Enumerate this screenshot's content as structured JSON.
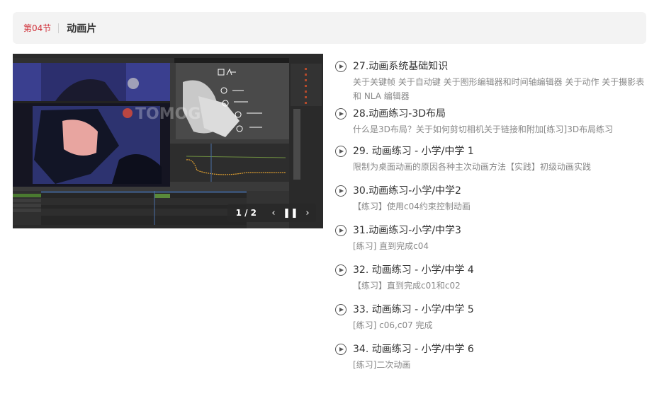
{
  "section": {
    "number": "第04节",
    "title": "动画片"
  },
  "video": {
    "counter": "1 / 2",
    "logo_text": "TOMOG"
  },
  "lessons": [
    {
      "title": "27.动画系统基础知识",
      "desc": "关于关键帧 关于自动键 关于图形编辑器和时间轴编辑器 关于动作 关于摄影表和 NLA 编辑器"
    },
    {
      "title": "28.动画练习-3D布局",
      "desc": "什么是3D布局？关于如何剪切相机关于链接和附加[练习]3D布局练习"
    },
    {
      "title": "29. 动画练习 - 小学/中学 1",
      "desc": "限制为桌面动画的原因各种主次动画方法【实践】初级动画实践"
    },
    {
      "title": "30.动画练习-小学/中学2",
      "desc": "【练习】使用c04约束控制动画"
    },
    {
      "title": "31.动画练习-小学/中学3",
      "desc": "[练习] 直到完成c04"
    },
    {
      "title": "32. 动画练习 - 小学/中学 4",
      "desc": "【练习】直到完成c01和c02"
    },
    {
      "title": "33. 动画练习 - 小学/中学 5",
      "desc": "[练习] c06,c07 完成"
    },
    {
      "title": "34. 动画练习 - 小学/中学 6",
      "desc": "[练习]二次动画"
    }
  ]
}
